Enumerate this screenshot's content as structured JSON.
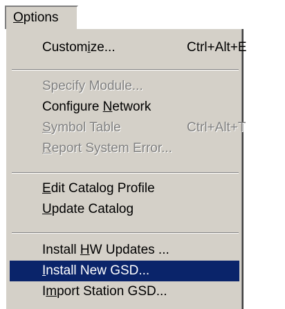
{
  "menubar": {
    "title_mnemonic": "O",
    "title_rest": "ptions"
  },
  "items": [
    {
      "pre": "Custom",
      "mn": "i",
      "post": "ze...",
      "shortcut": "Ctrl+Alt+E",
      "enabled": true
    },
    {
      "pre": "Specify Module...",
      "mn": "",
      "post": "",
      "shortcut": "",
      "enabled": false
    },
    {
      "pre": "Configure ",
      "mn": "N",
      "post": "etwork",
      "shortcut": "",
      "enabled": true
    },
    {
      "pre": "",
      "mn": "S",
      "post": "ymbol Table",
      "shortcut": "Ctrl+Alt+T",
      "enabled": false
    },
    {
      "pre": "",
      "mn": "R",
      "post": "eport System Error...",
      "shortcut": "",
      "enabled": false
    },
    {
      "pre": "",
      "mn": "E",
      "post": "dit Catalog Profile",
      "shortcut": "",
      "enabled": true
    },
    {
      "pre": "",
      "mn": "U",
      "post": "pdate Catalog",
      "shortcut": "",
      "enabled": true
    },
    {
      "pre": "Install ",
      "mn": "H",
      "post": "W Updates ...",
      "shortcut": "",
      "enabled": true
    },
    {
      "pre": "",
      "mn": "I",
      "post": "nstall New GSD...",
      "shortcut": "",
      "enabled": true,
      "selected": true
    },
    {
      "pre": "I",
      "mn": "m",
      "post": "port Station GSD...",
      "shortcut": "",
      "enabled": true
    }
  ]
}
